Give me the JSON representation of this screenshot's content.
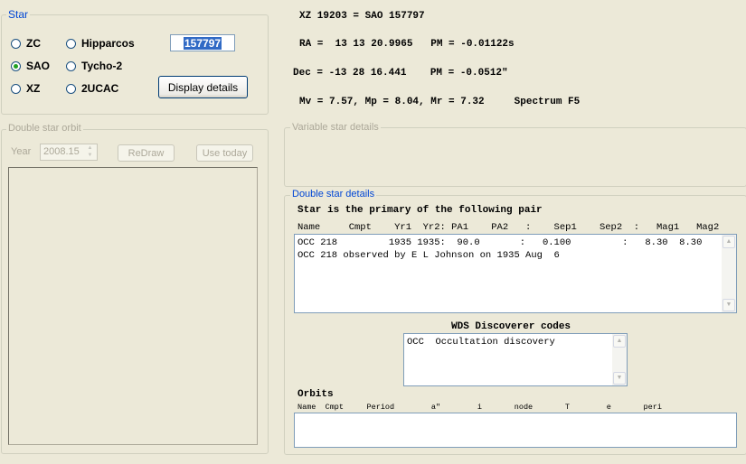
{
  "star_group": {
    "title": "Star",
    "radios": [
      {
        "label": "ZC",
        "checked": false
      },
      {
        "label": "Hipparcos",
        "checked": false
      },
      {
        "label": "SAO",
        "checked": true
      },
      {
        "label": "Tycho-2",
        "checked": false
      },
      {
        "label": "XZ",
        "checked": false
      },
      {
        "label": "2UCAC",
        "checked": false
      }
    ],
    "star_number_value": "157797",
    "display_details_label": "Display details"
  },
  "info": {
    "line1": "XZ 19203 = SAO 157797",
    "line2": "RA =  13 13 20.9965   PM = -0.01122s",
    "line3": "Dec = -13 28 16.441    PM = -0.0512\"",
    "line4": "Mv = 7.57, Mp = 8.04, Mr = 7.32     Spectrum F5"
  },
  "orbit_group": {
    "title": "Double star orbit",
    "year_label": "Year",
    "year_value": "2008.15",
    "redraw_label": "ReDraw",
    "use_today_label": "Use today"
  },
  "variable_group": {
    "title": "Variable star details"
  },
  "double_group": {
    "title": "Double star details",
    "heading": "Star is the primary of the following pair",
    "columns": "Name     Cmpt    Yr1  Yr2: PA1    PA2   :    Sep1    Sep2  :   Mag1   Mag2",
    "rows": [
      "OCC 218         1935 1935:  90.0       :   0.100         :   8.30  8.30",
      "OCC 218 observed by E L Johnson on 1935 Aug  6"
    ],
    "wds_title": "WDS Discoverer codes",
    "wds_rows": [
      "OCC  Occultation discovery"
    ],
    "orbits_title": "Orbits",
    "orbits_columns": "Name  Cmpt     Period        a\"        i       node       T        e       peri"
  }
}
